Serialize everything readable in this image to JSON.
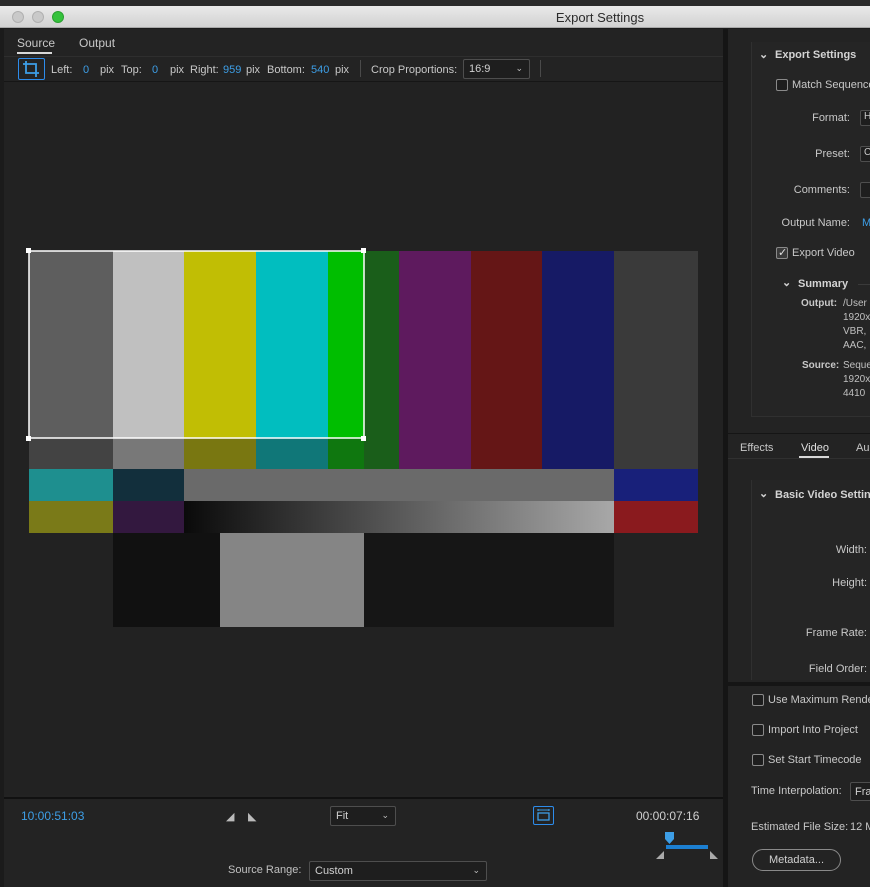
{
  "window": {
    "title": "Export Settings",
    "traffic_lights": [
      "#c9c9c9",
      "#c9c9c9",
      "#35c23c"
    ]
  },
  "left": {
    "tabs": [
      {
        "label": "Source",
        "active": true
      },
      {
        "label": "Output",
        "active": false
      }
    ],
    "crop": {
      "left_label": "Left:",
      "left_value": "0",
      "left_unit": "pix",
      "top_label": "Top:",
      "top_value": "0",
      "top_unit": "pix",
      "right_label": "Right:",
      "right_value": "959",
      "right_unit": "pix",
      "bottom_label": "Bottom:",
      "bottom_value": "540",
      "bottom_unit": "pix",
      "proportions_label": "Crop Proportions:",
      "proportions_value": "16:9"
    },
    "bars": {
      "top": [
        "#5e5e5e",
        "#c0c0c0",
        "#c1be04",
        "#01bebf",
        "#00be00",
        "#1a5e1a",
        "#5e1a5e",
        "#651616",
        "#161a65",
        "#3a3a3a"
      ],
      "mid": [
        "#1e8f8f",
        "#122f3c",
        "#6a6a6a",
        "#18207a"
      ],
      "low": [
        "#7a7a18",
        "#33183f",
        "#8a1a1e"
      ],
      "base": [
        "#111111",
        "#858585",
        "#161616"
      ]
    },
    "timecode_in": "10:00:51:03",
    "timecode_duration": "00:00:07:16",
    "zoom": "Fit",
    "source_range_label": "Source Range:",
    "source_range_value": "Custom"
  },
  "right": {
    "export_settings_header": "Export Settings",
    "match_sequence": {
      "label": "Match Sequence",
      "checked": false
    },
    "format_label": "Format:",
    "preset_label": "Preset:",
    "comments_label": "Comments:",
    "output_name_label": "Output Name:",
    "output_name_value": "M",
    "export_video": {
      "label": "Export Video",
      "checked": true
    },
    "summary_header": "Summary",
    "summary_output_label": "Output:",
    "summary_output_lines": [
      "/User",
      "1920x",
      "VBR,",
      "AAC,"
    ],
    "summary_source_label": "Source:",
    "summary_source_lines": [
      "Seque",
      "1920x",
      "4410"
    ],
    "tabs": [
      {
        "label": "Effects",
        "active": false
      },
      {
        "label": "Video",
        "active": true
      },
      {
        "label": "Au",
        "active": false
      }
    ],
    "basic_video_header": "Basic Video Setting",
    "width_label": "Width:",
    "height_label": "Height:",
    "frame_rate_label": "Frame Rate:",
    "field_order_label": "Field Order:",
    "use_max_render": {
      "label": "Use Maximum Rende",
      "checked": false
    },
    "import_into_project": {
      "label": "Import Into Project",
      "checked": false
    },
    "set_start_timecode": {
      "label": "Set Start Timecode",
      "checked": false
    },
    "time_interpolation_label": "Time Interpolation:",
    "time_interpolation_value": "Fra",
    "estimated_size_label": "Estimated File Size:",
    "estimated_size_value": "12 M",
    "metadata_button": "Metadata..."
  }
}
